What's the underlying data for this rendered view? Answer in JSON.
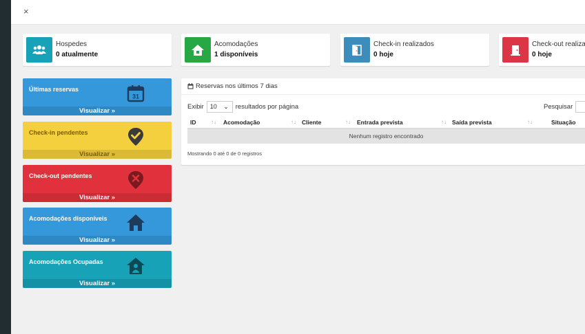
{
  "topbar": {
    "close_glyph": "×"
  },
  "info_boxes": [
    {
      "label": "Hospedes",
      "value": "0 atualmente",
      "color": "#17a2b8",
      "icon": "users-icon"
    },
    {
      "label": "Acomodações",
      "value": "1 disponíveis",
      "color": "#28a745",
      "icon": "home-icon"
    },
    {
      "label": "Check-in realizados",
      "value": "0 hoje",
      "color": "#3c8dbc",
      "icon": "door-open-icon"
    },
    {
      "label": "Check-out realizados",
      "value": "0 hoje",
      "color": "#dc3545",
      "icon": "door-exit-icon"
    }
  ],
  "small_boxes": [
    {
      "label": "Últimas reservas",
      "footer": "Visualizar »",
      "color": "#3498db",
      "icon": "calendar-icon",
      "icon_text": "31"
    },
    {
      "label": "Check-in pendentes",
      "footer": "Visualizar »",
      "color": "#f4d03f",
      "icon": "check-pin-icon"
    },
    {
      "label": "Check-out pendentes",
      "footer": "Visualizar »",
      "color": "#e0313c",
      "icon": "x-pin-icon"
    },
    {
      "label": "Acomodações disponíveis",
      "footer": "Visualizar »",
      "color": "#3498db",
      "icon": "house-icon"
    },
    {
      "label": "Acomodações Ocupadas",
      "footer": "Visualizar »",
      "color": "#17a2b8",
      "icon": "house-user-icon"
    }
  ],
  "panel": {
    "title": "Reservas nos últimos 7 dias",
    "length_prefix": "Exibir",
    "length_value": "10",
    "length_suffix": "resultados por página",
    "search_label": "Pesquisar",
    "columns": [
      "ID",
      "Acomodação",
      "Cliente",
      "Entrada prevista",
      "Saída prevista",
      "Situação"
    ],
    "empty_text": "Nenhum registro encontrado",
    "info_text": "Mostrando 0 até 0 de 0 registros"
  }
}
